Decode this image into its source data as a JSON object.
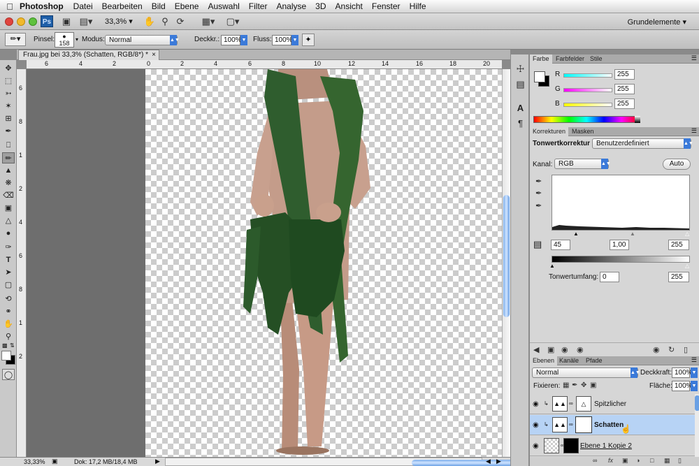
{
  "menubar": {
    "app": "Photoshop",
    "items": [
      "Datei",
      "Bearbeiten",
      "Bild",
      "Ebene",
      "Auswahl",
      "Filter",
      "Analyse",
      "3D",
      "Ansicht",
      "Fenster",
      "Hilfe"
    ]
  },
  "appbar": {
    "badge": "Ps",
    "zoom": "33,3%",
    "workspace": "Grundelemente"
  },
  "options": {
    "brush_label": "Pinsel:",
    "brush_size": "158",
    "mode_label": "Modus:",
    "mode_value": "Normal",
    "opacity_label": "Deckkr.:",
    "opacity_value": "100%",
    "flow_label": "Fluss:",
    "flow_value": "100%"
  },
  "document": {
    "tab_title": "Frau.jpg bei 33,3% (Schatten, RGB/8*) *"
  },
  "ruler": {
    "h_ticks": [
      "6",
      "4",
      "2",
      "0",
      "2",
      "4",
      "6",
      "8",
      "10",
      "12",
      "14",
      "16",
      "18",
      "20"
    ],
    "v_ticks": [
      "6",
      "8",
      "1",
      "2",
      "4",
      "6",
      "8",
      "1",
      "2"
    ]
  },
  "status": {
    "zoom": "33,33%",
    "doc": "Dok: 17,2 MB/18,4 MB"
  },
  "color_panel": {
    "tabs": [
      "Farbe",
      "Farbfelder",
      "Stile"
    ],
    "channels": [
      {
        "label": "R",
        "value": "255"
      },
      {
        "label": "G",
        "value": "255"
      },
      {
        "label": "B",
        "value": "255"
      }
    ]
  },
  "adjust_panel": {
    "tabs": [
      "Korrekturen",
      "Masken"
    ],
    "title": "Tonwertkorrektur",
    "preset": "Benutzerdefiniert",
    "channel_label": "Kanal:",
    "channel": "RGB",
    "auto": "Auto",
    "input_black": "45",
    "input_gamma": "1,00",
    "input_white": "255",
    "output_label": "Tonwertumfang:",
    "output_black": "0",
    "output_white": "255"
  },
  "layers_panel": {
    "tabs": [
      "Ebenen",
      "Kanäle",
      "Pfade"
    ],
    "blend": "Normal",
    "opacity_label": "Deckkraft:",
    "opacity": "100%",
    "lock_label": "Fixieren:",
    "fill_label": "Fläche:",
    "fill": "100%",
    "layers": [
      {
        "name": "Spitzlicher",
        "selected": false
      },
      {
        "name": "Schatten",
        "selected": true
      },
      {
        "name": "Ebene 1 Kopie 2",
        "selected": false
      }
    ]
  },
  "colors": {
    "selection": "#b7d3f5",
    "accent": "#3b7ad9"
  }
}
